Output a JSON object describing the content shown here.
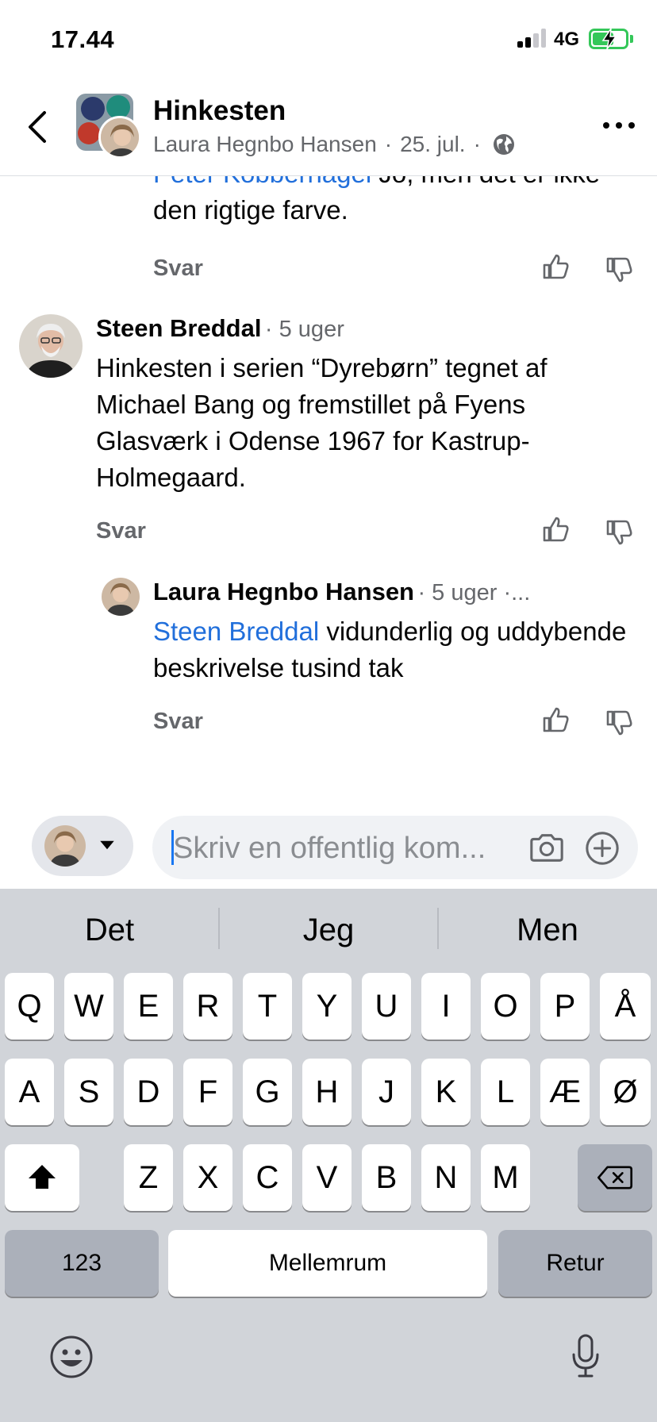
{
  "status_bar": {
    "time": "17.44",
    "network": "4G"
  },
  "header": {
    "title": "Hinkesten",
    "author": "Laura Hegnbo Hansen",
    "date": "25. jul.",
    "separator": "·"
  },
  "comments": [
    {
      "mention": "Peter Kobbernagel",
      "text": " Jo, men det er ikke den rigtige farve.",
      "reply_label": "Svar"
    },
    {
      "author": "Steen Breddal",
      "time": "· 5 uger",
      "text": "Hinkesten i serien “Dyrebørn” tegnet af Michael Bang og fremstillet på Fyens Glasværk i Odense 1967 for Kastrup-Holmegaard.",
      "reply_label": "Svar"
    },
    {
      "author": "Laura Hegnbo Hansen",
      "time": "· 5 uger ·...",
      "mention": "Steen Breddal",
      "text": " vidunderlig og uddybende beskrivelse tusind tak",
      "reply_label": "Svar"
    }
  ],
  "composer": {
    "placeholder": "Skriv en offentlig kom..."
  },
  "keyboard": {
    "suggestions": [
      "Det",
      "Jeg",
      "Men"
    ],
    "row1": [
      "Q",
      "W",
      "E",
      "R",
      "T",
      "Y",
      "U",
      "I",
      "O",
      "P",
      "Å"
    ],
    "row2": [
      "A",
      "S",
      "D",
      "F",
      "G",
      "H",
      "J",
      "K",
      "L",
      "Æ",
      "Ø"
    ],
    "row3": [
      "Z",
      "X",
      "C",
      "V",
      "B",
      "N",
      "M"
    ],
    "numbers_label": "123",
    "space_label": "Mellemrum",
    "return_label": "Retur"
  },
  "icons": {
    "back": "chevron-left-icon",
    "more": "more-icon",
    "globe": "globe-icon",
    "like": "thumbs-up-icon",
    "dislike": "thumbs-down-icon",
    "camera": "camera-icon",
    "add": "plus-circle-icon",
    "shift": "shift-icon",
    "backspace": "backspace-icon",
    "emoji": "emoji-icon",
    "mic": "microphone-icon"
  },
  "colors": {
    "link": "#216fdb",
    "secondary_text": "#65676b",
    "keyboard_bg": "#d1d4d9"
  }
}
